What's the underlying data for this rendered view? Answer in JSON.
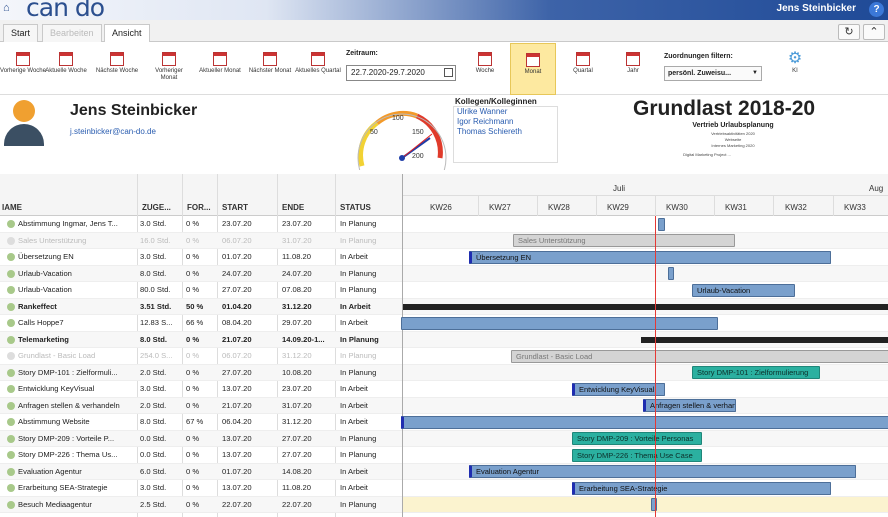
{
  "app": {
    "logo": "can do",
    "user": "Jens Steinbicker",
    "help": "?"
  },
  "tabs": [
    {
      "label": "Start"
    },
    {
      "label": "Bearbeiten"
    },
    {
      "label": "Ansicht"
    }
  ],
  "ribbon": {
    "buttons": [
      {
        "label": "Vorherige Woche"
      },
      {
        "label": "Aktuelle Woche"
      },
      {
        "label": "Nächste Woche"
      },
      {
        "label": "Vorheriger Monat"
      },
      {
        "label": "Aktueller Monat"
      },
      {
        "label": "Nächster Monat"
      },
      {
        "label": "Aktuelles Quartal"
      }
    ],
    "zeitraum_label": "Zeitraum:",
    "zeitraum_value": "22.7.2020-29.7.2020",
    "views": [
      {
        "label": "Woche"
      },
      {
        "label": "Monat"
      },
      {
        "label": "Quartal"
      },
      {
        "label": "Jahr"
      }
    ],
    "filter_label": "Zuordnungen filtern:",
    "filter_value": "persönl. Zuweisu...",
    "gear_label": "KI"
  },
  "profile": {
    "name": "Jens Steinbicker",
    "email": "j.steinbicker@can-do.de",
    "gauge_ticks": [
      "50",
      "100",
      "150",
      "200"
    ],
    "kollegen_title": "Kollegen/Kolleginnen",
    "kollegen": [
      "Ulrike Wanner",
      "Igor Reichmann",
      "Thomas Schiereth"
    ],
    "title": "Grundlast 2018-20",
    "subtitle": "Vertrieb Urlaubsplanung",
    "tiny_lines": [
      "Vertriebsaktivitäten 2020",
      "Webseite",
      "Internes Marketing 2020",
      "Digital Marketing Project ..."
    ]
  },
  "grid": {
    "columns": [
      "IAME",
      "ZUGE...",
      "FOR...",
      "START",
      "ENDE",
      "STATUS"
    ],
    "rows": [
      {
        "name": "Abstimmung Ingmar, Jens T...",
        "zuge": "3.0 Std.",
        "for": "0 %",
        "start": "23.07.20",
        "ende": "23.07.20",
        "status": "In Planung",
        "style": ""
      },
      {
        "name": "Sales Unterstützung",
        "zuge": "16.0 Std.",
        "for": "0 %",
        "start": "06.07.20",
        "ende": "31.07.20",
        "status": "In Planung",
        "style": "faded"
      },
      {
        "name": "Übersetzung EN",
        "zuge": "3.0 Std.",
        "for": "0 %",
        "start": "01.07.20",
        "ende": "11.08.20",
        "status": "In Arbeit",
        "style": ""
      },
      {
        "name": "Urlaub-Vacation",
        "zuge": "8.0 Std.",
        "for": "0 %",
        "start": "24.07.20",
        "ende": "24.07.20",
        "status": "In Planung",
        "style": ""
      },
      {
        "name": "Urlaub-Vacation",
        "zuge": "80.0 Std.",
        "for": "0 %",
        "start": "27.07.20",
        "ende": "07.08.20",
        "status": "In Planung",
        "style": ""
      },
      {
        "name": "Rankeffect",
        "zuge": "3.51 Std.",
        "for": "50 %",
        "start": "01.04.20",
        "ende": "31.12.20",
        "status": "In Arbeit",
        "style": "bold"
      },
      {
        "name": "Calls Hoppe7",
        "zuge": "12.83 S...",
        "for": "66 %",
        "start": "08.04.20",
        "ende": "29.07.20",
        "status": "In Arbeit",
        "style": ""
      },
      {
        "name": "Telemarketing",
        "zuge": "8.0 Std.",
        "for": "0 %",
        "start": "21.07.20",
        "ende": "14.09.20-1...",
        "status": "In Planung",
        "style": "bold"
      },
      {
        "name": "Grundlast - Basic Load",
        "zuge": "254.0 S...",
        "for": "0 %",
        "start": "06.07.20",
        "ende": "31.12.20",
        "status": "In Planung",
        "style": "faded"
      },
      {
        "name": "Story DMP-101 : Zielformuli...",
        "zuge": "2.0 Std.",
        "for": "0 %",
        "start": "27.07.20",
        "ende": "10.08.20",
        "status": "In Planung",
        "style": ""
      },
      {
        "name": "Entwicklung KeyVisual",
        "zuge": "3.0 Std.",
        "for": "0 %",
        "start": "13.07.20",
        "ende": "23.07.20",
        "status": "In Arbeit",
        "style": ""
      },
      {
        "name": "Anfragen stellen & verhandeln",
        "zuge": "2.0 Std.",
        "for": "0 %",
        "start": "21.07.20",
        "ende": "31.07.20",
        "status": "In Arbeit",
        "style": ""
      },
      {
        "name": "Abstimmung Website",
        "zuge": "8.0 Std.",
        "for": "67 %",
        "start": "06.04.20",
        "ende": "31.12.20",
        "status": "In Arbeit",
        "style": ""
      },
      {
        "name": "Story DMP-209 : Vorteile P...",
        "zuge": "0.0 Std.",
        "for": "0 %",
        "start": "13.07.20",
        "ende": "27.07.20",
        "status": "In Planung",
        "style": ""
      },
      {
        "name": "Story DMP-226 : Thema Us...",
        "zuge": "0.0 Std.",
        "for": "0 %",
        "start": "13.07.20",
        "ende": "27.07.20",
        "status": "In Planung",
        "style": ""
      },
      {
        "name": "Evaluation Agentur",
        "zuge": "6.0 Std.",
        "for": "0 %",
        "start": "01.07.20",
        "ende": "14.08.20",
        "status": "In Arbeit",
        "style": ""
      },
      {
        "name": "Erarbeitung SEA-Strategie",
        "zuge": "3.0 Std.",
        "for": "0 %",
        "start": "13.07.20",
        "ende": "11.08.20",
        "status": "In Arbeit",
        "style": ""
      },
      {
        "name": "Besuch Mediaagentur",
        "zuge": "2.5 Std.",
        "for": "0 %",
        "start": "22.07.20",
        "ende": "22.07.20",
        "status": "In Planung",
        "style": ""
      }
    ]
  },
  "gantt": {
    "months": [
      "Juli",
      "Aug"
    ],
    "weeks": [
      "KW26",
      "KW27",
      "KW28",
      "KW29",
      "KW30",
      "KW31",
      "KW32",
      "KW33"
    ],
    "bar_labels": [
      "Sales Unterstützung",
      "Übersetzung EN",
      "Urlaub-Vacation",
      "Grundlast - Basic Load",
      "Story DMP-101 : Zielformulierung",
      "Entwicklung KeyVisual",
      "Anfragen stellen & verhandeln",
      "Story DMP-209 : Vorteile Personas",
      "Story DMP-226 : Thema Use Case",
      "Evaluation Agentur",
      "Erarbeitung SEA-Strategie"
    ]
  }
}
